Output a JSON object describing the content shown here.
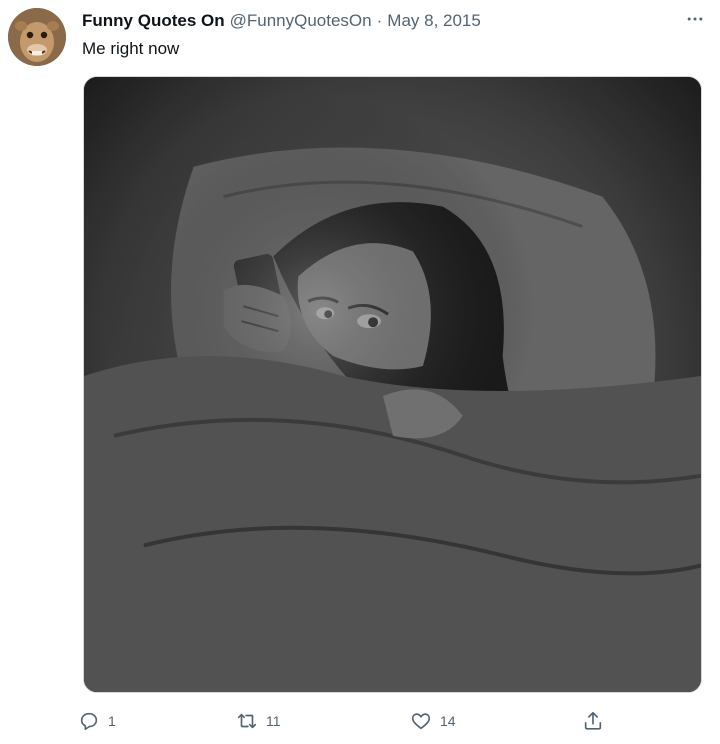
{
  "tweet": {
    "display_name": "Funny Quotes On",
    "handle": "@FunnyQuotesOn",
    "separator": "·",
    "date": "May 8, 2015",
    "text": "Me right now"
  },
  "media": {
    "description_icon": "cartoon-girl-in-bed-on-phone",
    "tint": "grayscale"
  },
  "actions": {
    "reply_count": "1",
    "retweet_count": "11",
    "like_count": "14"
  },
  "colors": {
    "text_primary": "#0f1419",
    "text_secondary": "#536471",
    "border": "#cfd9de"
  }
}
